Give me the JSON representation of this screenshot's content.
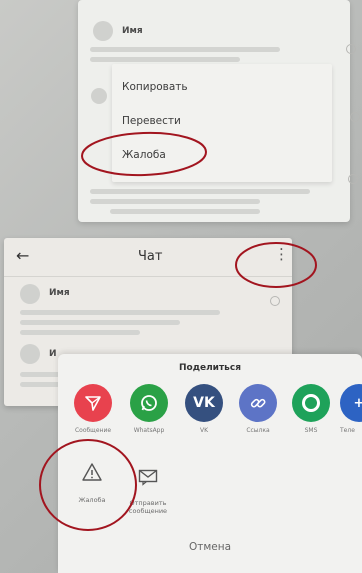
{
  "context_menu": {
    "author_name": "Имя",
    "items": [
      {
        "label": "Копировать"
      },
      {
        "label": "Перевести"
      },
      {
        "label": "Жалоба"
      }
    ]
  },
  "chat": {
    "title": "Чат",
    "message_author": "Имя",
    "message_author_partial": "И"
  },
  "share_sheet": {
    "title": "Поделиться",
    "targets": [
      {
        "label": "Сообщение",
        "icon": "send-icon",
        "color": "#e8424e"
      },
      {
        "label": "WhatsApp",
        "icon": "whatsapp-icon",
        "color": "#2aa146"
      },
      {
        "label": "VK",
        "icon": "vk-icon",
        "color": "#35507f"
      },
      {
        "label": "Ссылка",
        "icon": "link-icon",
        "color": "#5d74c6"
      },
      {
        "label": "SMS",
        "icon": "sms-icon",
        "color": "#1ea25a"
      },
      {
        "label": "Теле",
        "icon": "telegram-icon",
        "color": "#2d63c3"
      }
    ],
    "actions": [
      {
        "label": "Жалоба",
        "icon": "warning-icon"
      },
      {
        "label": "Отправить сообщение",
        "icon": "message-icon"
      }
    ],
    "cancel_label": "Отмена"
  },
  "annotation_color": "#a2151f"
}
